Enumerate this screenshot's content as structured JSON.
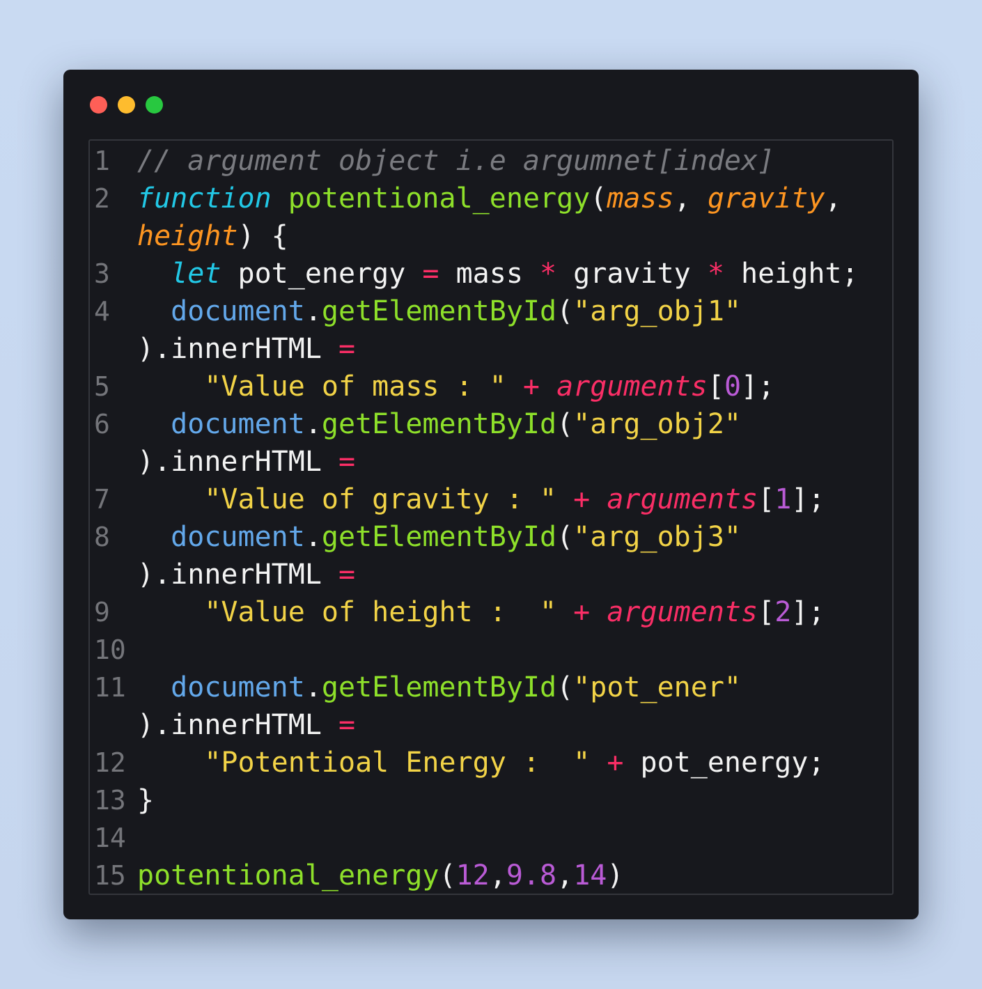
{
  "window": {
    "controls": [
      "close",
      "minimize",
      "maximize"
    ],
    "colors": {
      "close": "#fe5f57",
      "minimize": "#febc2e",
      "maximize": "#28c840"
    }
  },
  "editor": {
    "line_numbers": [
      "1",
      "2",
      "3",
      "4",
      "5",
      "6",
      "7",
      "8",
      "9",
      "10",
      "11",
      "12",
      "13",
      "14",
      "15"
    ],
    "lines": [
      {
        "t": [
          "// argument object i.e argumnet[index]"
        ]
      },
      {
        "t": [
          "function",
          " ",
          "potentional_energy",
          "(",
          "mass",
          ", ",
          "gravity",
          ","
        ]
      },
      {
        "t": [
          "height",
          ") {"
        ]
      },
      {
        "t": [
          "  ",
          "let",
          " pot_energy ",
          "=",
          " mass ",
          "*",
          " gravity ",
          "*",
          " height;"
        ]
      },
      {
        "t": [
          "  ",
          "document",
          ".",
          "getElementById",
          "(",
          "\"arg_obj1\""
        ]
      },
      {
        "t": [
          ").innerHTML ",
          "="
        ]
      },
      {
        "t": [
          "    ",
          "\"Value of mass : \"",
          " ",
          "+",
          " ",
          "arguments",
          "[",
          "0",
          "];"
        ]
      },
      {
        "t": [
          "  ",
          "document",
          ".",
          "getElementById",
          "(",
          "\"arg_obj2\""
        ]
      },
      {
        "t": [
          ").innerHTML ",
          "="
        ]
      },
      {
        "t": [
          "    ",
          "\"Value of gravity : \"",
          " ",
          "+",
          " ",
          "arguments",
          "[",
          "1",
          "];"
        ]
      },
      {
        "t": [
          "  ",
          "document",
          ".",
          "getElementById",
          "(",
          "\"arg_obj3\""
        ]
      },
      {
        "t": [
          ").innerHTML ",
          "="
        ]
      },
      {
        "t": [
          "    ",
          "\"Value of height :  \"",
          " ",
          "+",
          " ",
          "arguments",
          "[",
          "2",
          "];"
        ]
      },
      {
        "t": [
          ""
        ]
      },
      {
        "t": [
          "  ",
          "document",
          ".",
          "getElementById",
          "(",
          "\"pot_ener\""
        ]
      },
      {
        "t": [
          ").innerHTML ",
          "="
        ]
      },
      {
        "t": [
          "    ",
          "\"Potentioal Energy :  \"",
          " ",
          "+",
          " pot_energy;"
        ]
      },
      {
        "t": [
          "}"
        ]
      },
      {
        "t": [
          ""
        ]
      },
      {
        "t": [
          "potentional_energy",
          "(",
          "12",
          ",",
          "9.8",
          ",",
          "14",
          ")"
        ]
      }
    ]
  },
  "syntax_colors": {
    "comment": "#7a7b80",
    "keyword": "#22c8e6",
    "function": "#8ee02a",
    "param": "#fd9521",
    "operator": "#fa2e66",
    "object": "#63a8ea",
    "string": "#f2d347",
    "number": "#ba5bd6",
    "plain": "#f3f3f3"
  }
}
